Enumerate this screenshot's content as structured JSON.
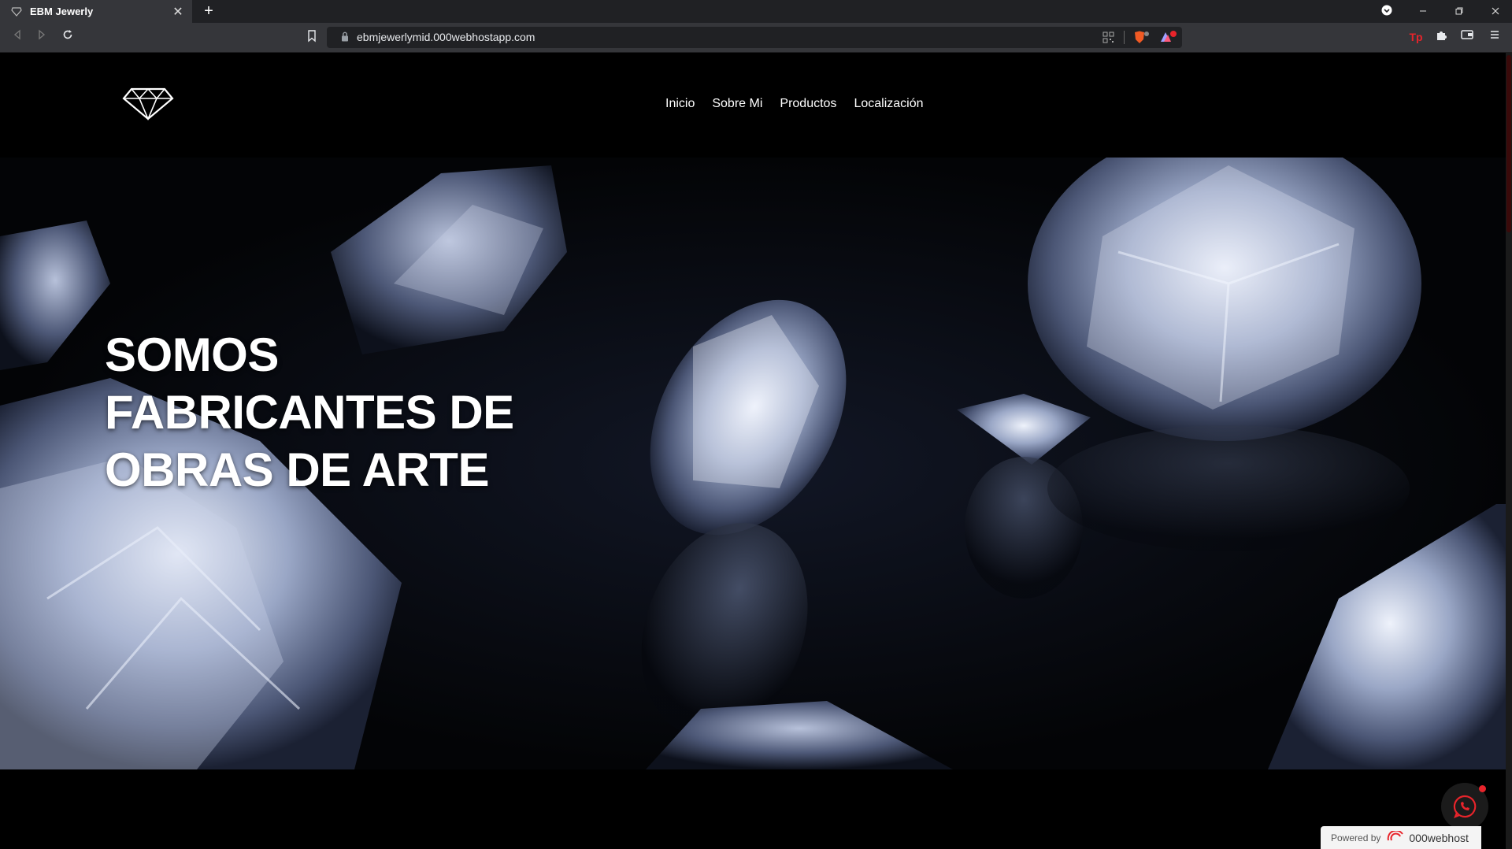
{
  "browser": {
    "tab_title": "EBM Jewerly",
    "url": "ebmjewerlymid.000webhostapp.com",
    "tab_close": "✕",
    "new_tab": "+"
  },
  "site": {
    "nav": [
      "Inicio",
      "Sobre Mi",
      "Productos",
      "Localización"
    ],
    "hero_title": "SOMOS FABRICANTES DE OBRAS DE ARTE"
  },
  "footer": {
    "powered_by": "Powered by",
    "host": "000webhost"
  },
  "colors": {
    "accent": "#e8242b",
    "page_bg": "#000000"
  }
}
